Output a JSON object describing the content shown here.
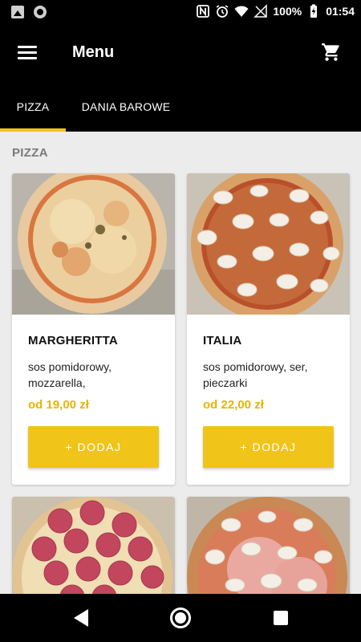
{
  "status_bar": {
    "battery": "100%",
    "time": "01:54"
  },
  "app_bar": {
    "title": "Menu",
    "menu_icon": "hamburger-menu-icon",
    "cart_icon": "shopping-cart-icon"
  },
  "tabs": [
    {
      "label": "PIZZA",
      "selected": true
    },
    {
      "label": "DANIA BAROWE",
      "selected": false
    }
  ],
  "section": {
    "title": "PIZZA"
  },
  "products": [
    {
      "name": "MARGHERITTA",
      "description": "sos pomidorowy, mozzarella,",
      "price": "od 19,00 zł",
      "button": "+ DODAJ",
      "image": "margherita-pizza-photo"
    },
    {
      "name": "ITALIA",
      "description": "sos pomidorowy, ser, pieczarki",
      "price": "od 22,00 zł",
      "button": "+ DODAJ",
      "image": "mushroom-pizza-photo"
    },
    {
      "image": "salami-pizza-photo"
    },
    {
      "image": "ham-mushroom-pizza-photo"
    }
  ],
  "colors": {
    "accent": "#f0c419",
    "price": "#e8b400",
    "background": "#ececec",
    "bars": "#000000"
  }
}
